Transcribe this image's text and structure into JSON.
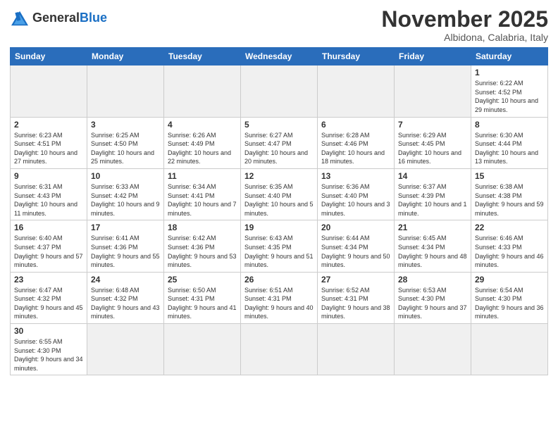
{
  "header": {
    "logo_general": "General",
    "logo_blue": "Blue",
    "month": "November 2025",
    "location": "Albidona, Calabria, Italy"
  },
  "weekdays": [
    "Sunday",
    "Monday",
    "Tuesday",
    "Wednesday",
    "Thursday",
    "Friday",
    "Saturday"
  ],
  "weeks": [
    [
      {
        "day": "",
        "info": ""
      },
      {
        "day": "",
        "info": ""
      },
      {
        "day": "",
        "info": ""
      },
      {
        "day": "",
        "info": ""
      },
      {
        "day": "",
        "info": ""
      },
      {
        "day": "",
        "info": ""
      },
      {
        "day": "1",
        "info": "Sunrise: 6:22 AM\nSunset: 4:52 PM\nDaylight: 10 hours and 29 minutes."
      }
    ],
    [
      {
        "day": "2",
        "info": "Sunrise: 6:23 AM\nSunset: 4:51 PM\nDaylight: 10 hours and 27 minutes."
      },
      {
        "day": "3",
        "info": "Sunrise: 6:25 AM\nSunset: 4:50 PM\nDaylight: 10 hours and 25 minutes."
      },
      {
        "day": "4",
        "info": "Sunrise: 6:26 AM\nSunset: 4:49 PM\nDaylight: 10 hours and 22 minutes."
      },
      {
        "day": "5",
        "info": "Sunrise: 6:27 AM\nSunset: 4:47 PM\nDaylight: 10 hours and 20 minutes."
      },
      {
        "day": "6",
        "info": "Sunrise: 6:28 AM\nSunset: 4:46 PM\nDaylight: 10 hours and 18 minutes."
      },
      {
        "day": "7",
        "info": "Sunrise: 6:29 AM\nSunset: 4:45 PM\nDaylight: 10 hours and 16 minutes."
      },
      {
        "day": "8",
        "info": "Sunrise: 6:30 AM\nSunset: 4:44 PM\nDaylight: 10 hours and 13 minutes."
      }
    ],
    [
      {
        "day": "9",
        "info": "Sunrise: 6:31 AM\nSunset: 4:43 PM\nDaylight: 10 hours and 11 minutes."
      },
      {
        "day": "10",
        "info": "Sunrise: 6:33 AM\nSunset: 4:42 PM\nDaylight: 10 hours and 9 minutes."
      },
      {
        "day": "11",
        "info": "Sunrise: 6:34 AM\nSunset: 4:41 PM\nDaylight: 10 hours and 7 minutes."
      },
      {
        "day": "12",
        "info": "Sunrise: 6:35 AM\nSunset: 4:40 PM\nDaylight: 10 hours and 5 minutes."
      },
      {
        "day": "13",
        "info": "Sunrise: 6:36 AM\nSunset: 4:40 PM\nDaylight: 10 hours and 3 minutes."
      },
      {
        "day": "14",
        "info": "Sunrise: 6:37 AM\nSunset: 4:39 PM\nDaylight: 10 hours and 1 minute."
      },
      {
        "day": "15",
        "info": "Sunrise: 6:38 AM\nSunset: 4:38 PM\nDaylight: 9 hours and 59 minutes."
      }
    ],
    [
      {
        "day": "16",
        "info": "Sunrise: 6:40 AM\nSunset: 4:37 PM\nDaylight: 9 hours and 57 minutes."
      },
      {
        "day": "17",
        "info": "Sunrise: 6:41 AM\nSunset: 4:36 PM\nDaylight: 9 hours and 55 minutes."
      },
      {
        "day": "18",
        "info": "Sunrise: 6:42 AM\nSunset: 4:36 PM\nDaylight: 9 hours and 53 minutes."
      },
      {
        "day": "19",
        "info": "Sunrise: 6:43 AM\nSunset: 4:35 PM\nDaylight: 9 hours and 51 minutes."
      },
      {
        "day": "20",
        "info": "Sunrise: 6:44 AM\nSunset: 4:34 PM\nDaylight: 9 hours and 50 minutes."
      },
      {
        "day": "21",
        "info": "Sunrise: 6:45 AM\nSunset: 4:34 PM\nDaylight: 9 hours and 48 minutes."
      },
      {
        "day": "22",
        "info": "Sunrise: 6:46 AM\nSunset: 4:33 PM\nDaylight: 9 hours and 46 minutes."
      }
    ],
    [
      {
        "day": "23",
        "info": "Sunrise: 6:47 AM\nSunset: 4:32 PM\nDaylight: 9 hours and 45 minutes."
      },
      {
        "day": "24",
        "info": "Sunrise: 6:48 AM\nSunset: 4:32 PM\nDaylight: 9 hours and 43 minutes."
      },
      {
        "day": "25",
        "info": "Sunrise: 6:50 AM\nSunset: 4:31 PM\nDaylight: 9 hours and 41 minutes."
      },
      {
        "day": "26",
        "info": "Sunrise: 6:51 AM\nSunset: 4:31 PM\nDaylight: 9 hours and 40 minutes."
      },
      {
        "day": "27",
        "info": "Sunrise: 6:52 AM\nSunset: 4:31 PM\nDaylight: 9 hours and 38 minutes."
      },
      {
        "day": "28",
        "info": "Sunrise: 6:53 AM\nSunset: 4:30 PM\nDaylight: 9 hours and 37 minutes."
      },
      {
        "day": "29",
        "info": "Sunrise: 6:54 AM\nSunset: 4:30 PM\nDaylight: 9 hours and 36 minutes."
      }
    ],
    [
      {
        "day": "30",
        "info": "Sunrise: 6:55 AM\nSunset: 4:30 PM\nDaylight: 9 hours and 34 minutes."
      },
      {
        "day": "",
        "info": ""
      },
      {
        "day": "",
        "info": ""
      },
      {
        "day": "",
        "info": ""
      },
      {
        "day": "",
        "info": ""
      },
      {
        "day": "",
        "info": ""
      },
      {
        "day": "",
        "info": ""
      }
    ]
  ]
}
